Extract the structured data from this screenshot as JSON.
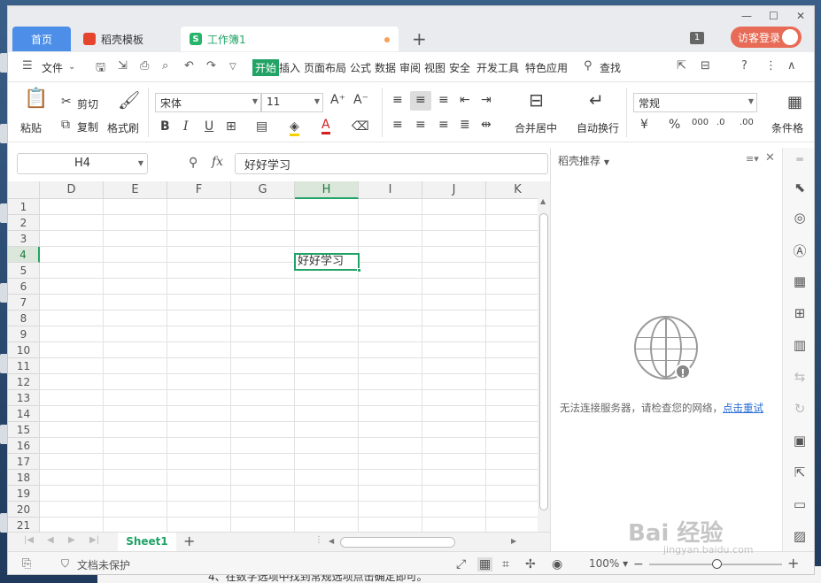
{
  "tabs": {
    "home": "首页",
    "template": "稻壳模板",
    "workbook": "工作簿1",
    "badge": "1",
    "login": "访客登录"
  },
  "menu": {
    "file": "文件",
    "items": [
      "开始",
      "插入",
      "页面布局",
      "公式",
      "数据",
      "审阅",
      "视图",
      "安全",
      "开发工具",
      "特色应用"
    ],
    "search": "查找"
  },
  "toolbar": {
    "paste": "粘贴",
    "cut": "剪切",
    "copy": "复制",
    "format_painter": "格式刷",
    "font_name": "宋体",
    "font_size": "11",
    "merge_center": "合并居中",
    "wrap_text": "自动换行",
    "number_format": "常规",
    "conditional_format": "条件格"
  },
  "formula_bar": {
    "name_box": "H4",
    "fx_label": "fx",
    "content": "好好学习"
  },
  "grid": {
    "columns": [
      "D",
      "E",
      "F",
      "G",
      "H",
      "I",
      "J",
      "K"
    ],
    "rows": [
      "1",
      "2",
      "3",
      "4",
      "5",
      "6",
      "7",
      "8",
      "9",
      "10",
      "11",
      "12",
      "13",
      "14",
      "15",
      "16",
      "17",
      "18",
      "19",
      "20",
      "21"
    ],
    "active_cell": "H4",
    "active_value": "好好学习"
  },
  "sheetbar": {
    "sheet_name": "Sheet1"
  },
  "status": {
    "protection": "文档未保护",
    "zoom": "100%"
  },
  "panel": {
    "title": "稻壳推荐",
    "error_text": "无法连接服务器，请检查您的网络，",
    "retry_link": "点击重试"
  },
  "background": {
    "doc_text": "4、在数字选项中找到常规选项点击确定即可。",
    "watermark": "Bai 经验",
    "watermark_url": "jingyan.baidu.com"
  },
  "colors": {
    "accent_green": "#21a366",
    "tab_blue": "#4d8fe8",
    "login_red": "#e76b56"
  }
}
